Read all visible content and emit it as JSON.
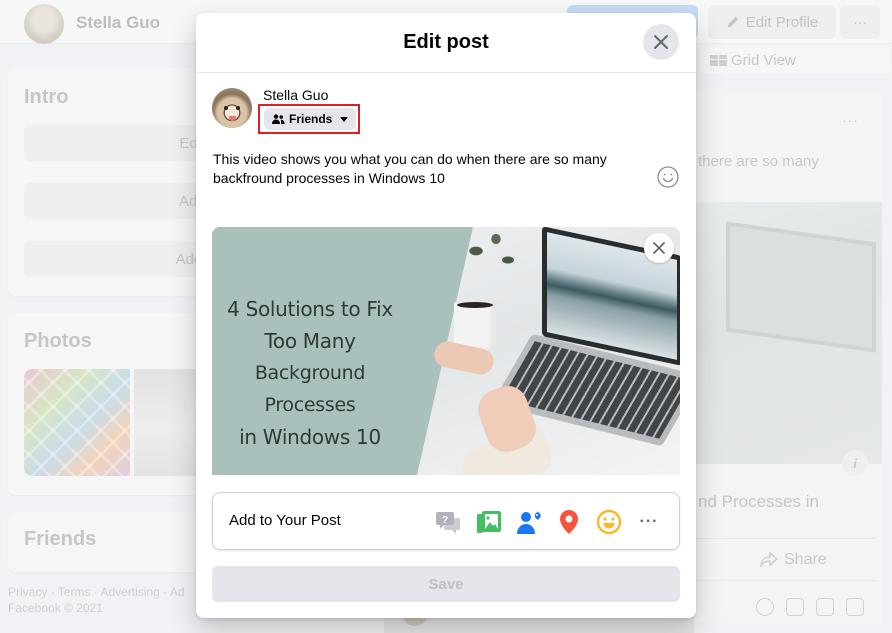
{
  "background": {
    "profile_name": "Stella Guo",
    "edit_profile_label": "Edit Profile",
    "more_label": "···",
    "grid_view_label": "Grid View",
    "intro": {
      "title": "Intro",
      "buttons": [
        "Edit De",
        "Add Ho",
        "Add Fea"
      ]
    },
    "photos": {
      "title": "Photos"
    },
    "friends": {
      "title": "Friends"
    },
    "footer": {
      "links": "Privacy · Terms · Advertising · Ad",
      "copyright": "Facebook © 2021"
    },
    "post": {
      "more_label": "···",
      "text_fragment": "there are so many",
      "link_title_fragment": "nd Processes in",
      "info_label": "i",
      "share_label": "Share"
    }
  },
  "modal": {
    "title": "Edit post",
    "author": {
      "name": "Stella Guo",
      "audience": "Friends"
    },
    "post_text": "This video shows you what you can do when there are so many backfround processes in Windows 10",
    "attachment": {
      "overlay_text_lines": [
        "4 Solutions to Fix",
        "Too Many",
        "Background Processes",
        "in Windows 10"
      ]
    },
    "add_to_post": {
      "label": "Add to Your Post",
      "icons": [
        "question-bubble-icon",
        "photo-video-icon",
        "tag-people-icon",
        "check-in-icon",
        "feeling-icon",
        "more-icon"
      ],
      "more_label": "···"
    },
    "save_label": "Save"
  },
  "colors": {
    "accent_blue": "#1877f2",
    "photo_green": "#45bd62",
    "checkin_red": "#f5533d",
    "feeling_yellow": "#f7b928",
    "highlight_red": "#e02020",
    "disabled_bg": "#e4e6eb",
    "disabled_text": "#bcc0c4"
  }
}
